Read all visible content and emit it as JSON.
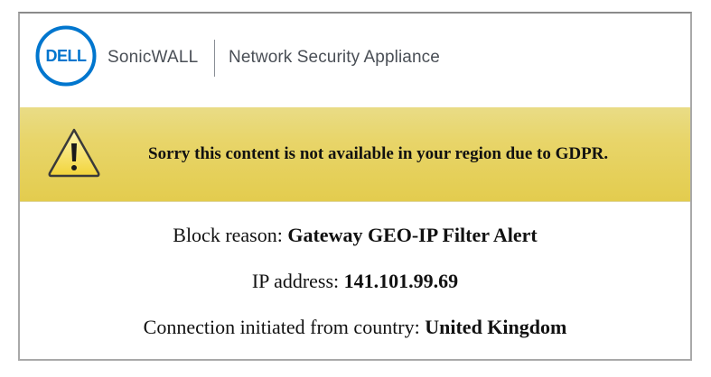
{
  "header": {
    "logo_text": "DELL",
    "brand": "SonicWALL",
    "product": "Network Security Appliance"
  },
  "banner": {
    "message": "Sorry this content is not available in your region due to GDPR.",
    "icon": "warning-triangle-icon"
  },
  "details": {
    "block_reason_label": "Block reason:",
    "block_reason_value": "Gateway GEO-IP Filter Alert",
    "ip_label": "IP address:",
    "ip_value": "141.101.99.69",
    "country_label": "Connection initiated from country:",
    "country_value": "United Kingdom"
  },
  "colors": {
    "dell_blue": "#0076ce",
    "banner_yellow": "#e8d56a",
    "text_gray": "#4a4f56"
  }
}
